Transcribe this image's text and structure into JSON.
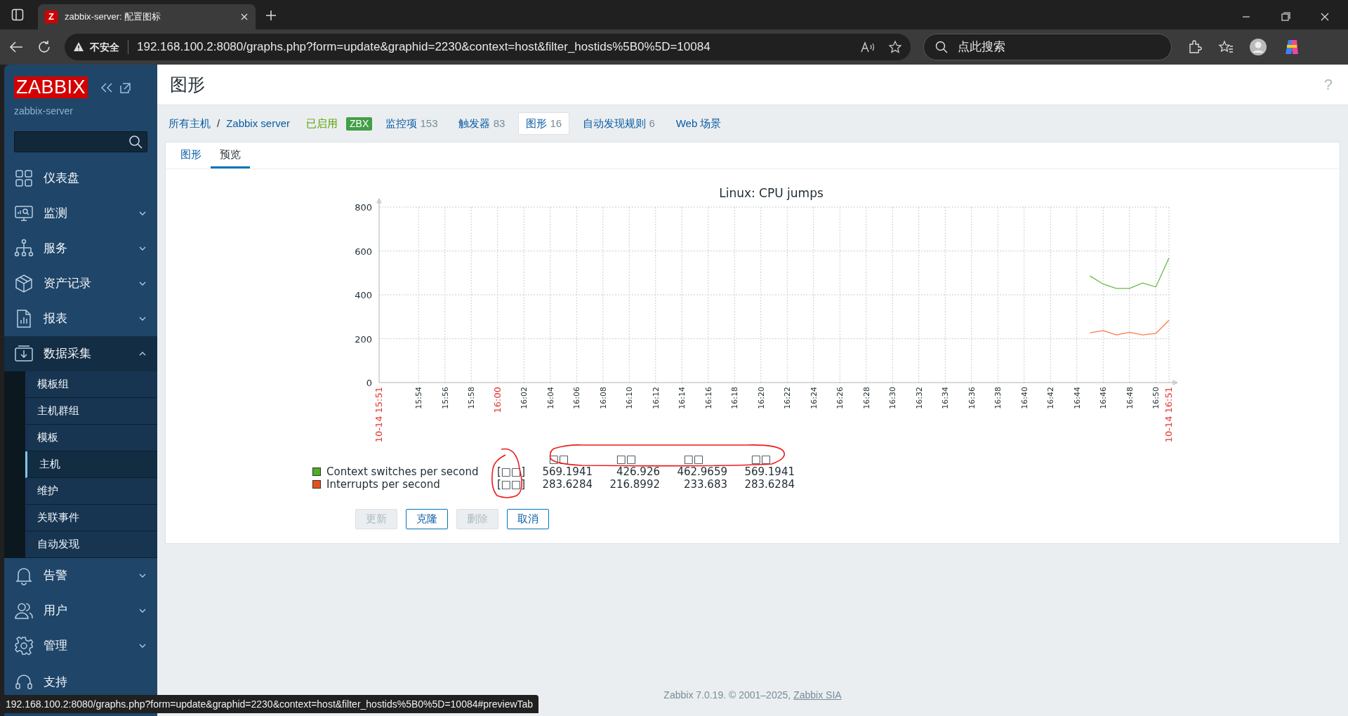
{
  "browser": {
    "tab_title": "zabbix-server: 配置图标",
    "tab_favicon": "Z",
    "security_label": "不安全",
    "url": "192.168.100.2:8080/graphs.php?form=update&graphid=2230&context=host&filter_hostids%5B0%5D=10084",
    "search_placeholder": "点此搜索"
  },
  "sidebar": {
    "logo": "ZABBIX",
    "server": "zabbix-server",
    "menu": [
      {
        "label": "仪表盘",
        "expanded": false,
        "caret": false
      },
      {
        "label": "监测",
        "expanded": false,
        "caret": true
      },
      {
        "label": "服务",
        "expanded": false,
        "caret": true
      },
      {
        "label": "资产记录",
        "expanded": false,
        "caret": true
      },
      {
        "label": "报表",
        "expanded": false,
        "caret": true
      },
      {
        "label": "数据采集",
        "expanded": true,
        "caret": true,
        "children": [
          {
            "label": "模板组",
            "selected": false
          },
          {
            "label": "主机群组",
            "selected": false
          },
          {
            "label": "模板",
            "selected": false
          },
          {
            "label": "主机",
            "selected": true
          },
          {
            "label": "维护",
            "selected": false
          },
          {
            "label": "关联事件",
            "selected": false
          },
          {
            "label": "自动发现",
            "selected": false
          }
        ]
      },
      {
        "label": "告警",
        "expanded": false,
        "caret": true
      },
      {
        "label": "用户",
        "expanded": false,
        "caret": true
      },
      {
        "label": "管理",
        "expanded": false,
        "caret": true
      },
      {
        "label": "支持",
        "expanded": false,
        "caret": false
      }
    ]
  },
  "page": {
    "title": "图形",
    "help": "?"
  },
  "breadcrumb": [
    {
      "kind": "link",
      "label": "所有主机"
    },
    {
      "kind": "separator",
      "label": "/"
    },
    {
      "kind": "link",
      "label": "Zabbix server"
    },
    {
      "kind": "status",
      "label": "已启用"
    },
    {
      "kind": "tag",
      "label": "ZBX"
    },
    {
      "kind": "count",
      "label": "监控项",
      "count": "153",
      "selected": false
    },
    {
      "kind": "count",
      "label": "触发器",
      "count": "83",
      "selected": false
    },
    {
      "kind": "count",
      "label": "图形",
      "count": "16",
      "selected": true
    },
    {
      "kind": "count",
      "label": "自动发现规则",
      "count": "6",
      "selected": false
    },
    {
      "kind": "count",
      "label": "Web 场景",
      "selected": false
    }
  ],
  "tabs": [
    {
      "label": "图形",
      "selected": false
    },
    {
      "label": "预览",
      "selected": true
    }
  ],
  "graph": {
    "chart_data": {
      "type": "line",
      "title": "Linux: CPU jumps",
      "grid": true,
      "ylim": [
        0,
        800
      ],
      "yticks": [
        0,
        200,
        400,
        600,
        800
      ],
      "categories": [
        "10-14 15:51",
        null,
        null,
        "15:54",
        null,
        "15:56",
        null,
        "15:58",
        null,
        "16:00",
        null,
        "16:02",
        null,
        "16:04",
        null,
        "16:06",
        null,
        "16:08",
        null,
        "16:10",
        null,
        "16:12",
        null,
        "16:14",
        null,
        "16:16",
        null,
        "16:18",
        null,
        "16:20",
        null,
        "16:22",
        null,
        "16:24",
        null,
        "16:26",
        null,
        "16:28",
        null,
        "16:30",
        null,
        "16:32",
        null,
        "16:34",
        null,
        "16:36",
        null,
        "16:38",
        null,
        "16:40",
        null,
        "16:42",
        null,
        "16:44",
        null,
        "16:46",
        null,
        "16:48",
        null,
        "16:50",
        "10-14 16:51"
      ],
      "series": [
        {
          "name": "Context switches per second",
          "color": "#66bb44",
          "values": [
            null,
            null,
            null,
            null,
            null,
            null,
            null,
            null,
            null,
            null,
            null,
            null,
            null,
            null,
            null,
            null,
            null,
            null,
            null,
            null,
            null,
            null,
            null,
            null,
            null,
            null,
            null,
            null,
            null,
            null,
            null,
            null,
            null,
            null,
            null,
            null,
            null,
            null,
            null,
            null,
            null,
            null,
            null,
            null,
            null,
            null,
            null,
            null,
            null,
            null,
            null,
            null,
            null,
            null,
            486,
            449,
            429,
            429,
            454,
            436,
            568
          ]
        },
        {
          "name": "Interrupts per second",
          "color": "#ff7744",
          "values": [
            null,
            null,
            null,
            null,
            null,
            null,
            null,
            null,
            null,
            null,
            null,
            null,
            null,
            null,
            null,
            null,
            null,
            null,
            null,
            null,
            null,
            null,
            null,
            null,
            null,
            null,
            null,
            null,
            null,
            null,
            null,
            null,
            null,
            null,
            null,
            null,
            null,
            null,
            null,
            null,
            null,
            null,
            null,
            null,
            null,
            null,
            null,
            null,
            null,
            null,
            null,
            null,
            null,
            null,
            227,
            237,
            217,
            229,
            217,
            224,
            284
          ]
        }
      ]
    },
    "legend_headers": [
      "□□",
      "□□",
      "□□",
      "□□"
    ],
    "legend": [
      {
        "color": "#4caf25",
        "function": "[□□]",
        "values": [
          "569.1941",
          "426.926",
          "462.9659",
          "569.1941"
        ]
      },
      {
        "color": "#e8501a",
        "function": "[□□]",
        "values": [
          "283.6284",
          "216.8992",
          "233.683",
          "283.6284"
        ]
      }
    ]
  },
  "buttons": [
    {
      "label": "更新",
      "disabled": true
    },
    {
      "label": "克隆",
      "disabled": false
    },
    {
      "label": "删除",
      "disabled": true
    },
    {
      "label": "取消",
      "disabled": false
    }
  ],
  "footer": {
    "text": "Zabbix 7.0.19. © 2001–2025,",
    "link": "Zabbix SIA"
  },
  "status_url": "192.168.100.2:8080/graphs.php?form=update&graphid=2230&context=host&filter_hostids%5B0%5D=10084#previewTab"
}
